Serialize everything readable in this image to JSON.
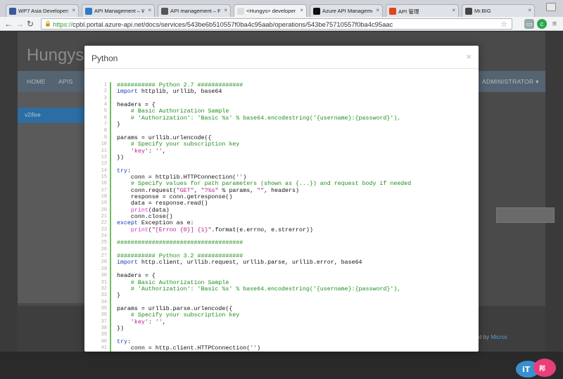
{
  "browser": {
    "tabs": [
      {
        "label": "WP7 Asia Developers",
        "favicon": "facebook-icon",
        "color": "#3b5998"
      },
      {
        "label": "API Management – Wi",
        "favicon": "windows-icon",
        "color": "#2d7cc4"
      },
      {
        "label": "API management – Pol",
        "favicon": "cloud-icon",
        "color": "#555555"
      },
      {
        "label": "<Hungys> developer",
        "favicon": "document-icon",
        "color": "#dddddd",
        "active": true
      },
      {
        "label": "Azure API Management",
        "favicon": "m-icon",
        "color": "#111111"
      },
      {
        "label": "API 管理",
        "favicon": "microsoft-icon",
        "color": "#e2441b"
      },
      {
        "label": "Mr.BIG",
        "favicon": "s-icon",
        "color": "#444444"
      }
    ],
    "url_scheme": "https://",
    "url_rest": "cpbl.portal.azure-api.net/docs/services/543be6b510557f0ba4c95aab/operations/543be75710557f0ba4c95aac"
  },
  "page": {
    "brand": "Hungys /",
    "nav": [
      "HOME",
      "APIS",
      "ADMINISTRATOR ▾"
    ],
    "sidebar_item": "v2/live",
    "footer_text": "d by",
    "footer_brand": "Micros"
  },
  "modal": {
    "title": "Python",
    "close": "×",
    "lines": [
      {
        "n": "1",
        "tokens": [
          {
            "t": "########### Python 2.7 #############",
            "c": "comment"
          }
        ]
      },
      {
        "n": "2",
        "tokens": [
          {
            "t": "import",
            "c": "kw"
          },
          {
            "t": " httplib, urllib, base64",
            "c": "plain"
          }
        ]
      },
      {
        "n": "3",
        "tokens": []
      },
      {
        "n": "4",
        "tokens": [
          {
            "t": "headers = {",
            "c": "plain"
          }
        ]
      },
      {
        "n": "5",
        "tokens": [
          {
            "t": "    # Basic Authorization Sample",
            "c": "comment"
          }
        ]
      },
      {
        "n": "6",
        "tokens": [
          {
            "t": "    # 'Authorization': 'Basic %s' % base64.encodestring('{username}:{password}'),",
            "c": "comment"
          }
        ]
      },
      {
        "n": "7",
        "tokens": [
          {
            "t": "}",
            "c": "plain"
          }
        ]
      },
      {
        "n": "8",
        "tokens": []
      },
      {
        "n": "9",
        "tokens": [
          {
            "t": "params = urllib.urlencode({",
            "c": "plain"
          }
        ]
      },
      {
        "n": "10",
        "tokens": [
          {
            "t": "    # Specify your subscription key",
            "c": "comment"
          }
        ]
      },
      {
        "n": "11",
        "tokens": [
          {
            "t": "    ",
            "c": "plain"
          },
          {
            "t": "'key'",
            "c": "str"
          },
          {
            "t": ": ",
            "c": "plain"
          },
          {
            "t": "''",
            "c": "str"
          },
          {
            "t": ",",
            "c": "plain"
          }
        ]
      },
      {
        "n": "12",
        "tokens": [
          {
            "t": "})",
            "c": "plain"
          }
        ]
      },
      {
        "n": "13",
        "tokens": []
      },
      {
        "n": "14",
        "tokens": [
          {
            "t": "try",
            "c": "kw"
          },
          {
            "t": ":",
            "c": "plain"
          }
        ]
      },
      {
        "n": "15",
        "tokens": [
          {
            "t": "    conn = httplib.HTTPConnection(",
            "c": "plain"
          },
          {
            "t": "''",
            "c": "str"
          },
          {
            "t": ")",
            "c": "plain"
          }
        ]
      },
      {
        "n": "16",
        "tokens": [
          {
            "t": "    # Specify values for path parameters (shown as {...}) and request body if needed",
            "c": "comment"
          }
        ]
      },
      {
        "n": "17",
        "tokens": [
          {
            "t": "    conn.request(",
            "c": "plain"
          },
          {
            "t": "\"GET\"",
            "c": "str"
          },
          {
            "t": ", ",
            "c": "plain"
          },
          {
            "t": "\"?%s\"",
            "c": "str"
          },
          {
            "t": " % params, ",
            "c": "plain"
          },
          {
            "t": "\"\"",
            "c": "str"
          },
          {
            "t": ", headers)",
            "c": "plain"
          }
        ]
      },
      {
        "n": "18",
        "tokens": [
          {
            "t": "    response = conn.getresponse()",
            "c": "plain"
          }
        ]
      },
      {
        "n": "19",
        "tokens": [
          {
            "t": "    data = response.read()",
            "c": "plain"
          }
        ]
      },
      {
        "n": "20",
        "tokens": [
          {
            "t": "    ",
            "c": "plain"
          },
          {
            "t": "print",
            "c": "fn"
          },
          {
            "t": "(data)",
            "c": "plain"
          }
        ]
      },
      {
        "n": "21",
        "tokens": [
          {
            "t": "    conn.close()",
            "c": "plain"
          }
        ]
      },
      {
        "n": "22",
        "tokens": [
          {
            "t": "except",
            "c": "kw"
          },
          {
            "t": " Exception as e:",
            "c": "plain"
          }
        ]
      },
      {
        "n": "23",
        "tokens": [
          {
            "t": "    ",
            "c": "plain"
          },
          {
            "t": "print",
            "c": "fn"
          },
          {
            "t": "(",
            "c": "plain"
          },
          {
            "t": "\"[Errno {0}] {1}\"",
            "c": "str"
          },
          {
            "t": ".format(e.errno, e.strerror))",
            "c": "plain"
          }
        ]
      },
      {
        "n": "24",
        "tokens": []
      },
      {
        "n": "25",
        "tokens": [
          {
            "t": "####################################",
            "c": "comment"
          }
        ]
      },
      {
        "n": "26",
        "tokens": []
      },
      {
        "n": "27",
        "tokens": [
          {
            "t": "########### Python 3.2 #############",
            "c": "comment"
          }
        ]
      },
      {
        "n": "28",
        "tokens": [
          {
            "t": "import",
            "c": "kw"
          },
          {
            "t": " http.client, urllib.request, urllib.parse, urllib.error, base64",
            "c": "plain"
          }
        ]
      },
      {
        "n": "29",
        "tokens": []
      },
      {
        "n": "30",
        "tokens": [
          {
            "t": "headers = {",
            "c": "plain"
          }
        ]
      },
      {
        "n": "31",
        "tokens": [
          {
            "t": "    # Basic Authorization Sample",
            "c": "comment"
          }
        ]
      },
      {
        "n": "32",
        "tokens": [
          {
            "t": "    # 'Authorization': 'Basic %s' % base64.encodestring('{username}:{password}'),",
            "c": "comment"
          }
        ]
      },
      {
        "n": "33",
        "tokens": [
          {
            "t": "}",
            "c": "plain"
          }
        ]
      },
      {
        "n": "34",
        "tokens": []
      },
      {
        "n": "35",
        "tokens": [
          {
            "t": "params = urllib.parse.urlencode({",
            "c": "plain"
          }
        ]
      },
      {
        "n": "36",
        "tokens": [
          {
            "t": "    # Specify your subscription key",
            "c": "comment"
          }
        ]
      },
      {
        "n": "37",
        "tokens": [
          {
            "t": "    ",
            "c": "plain"
          },
          {
            "t": "'key'",
            "c": "str"
          },
          {
            "t": ": ",
            "c": "plain"
          },
          {
            "t": "''",
            "c": "str"
          },
          {
            "t": ",",
            "c": "plain"
          }
        ]
      },
      {
        "n": "38",
        "tokens": [
          {
            "t": "})",
            "c": "plain"
          }
        ]
      },
      {
        "n": "39",
        "tokens": []
      },
      {
        "n": "40",
        "tokens": [
          {
            "t": "try",
            "c": "kw"
          },
          {
            "t": ":",
            "c": "plain"
          }
        ]
      },
      {
        "n": "41",
        "tokens": [
          {
            "t": "    conn = http.client.HTTPConnection(",
            "c": "plain"
          },
          {
            "t": "''",
            "c": "str"
          },
          {
            "t": ")",
            "c": "plain"
          }
        ]
      }
    ]
  },
  "colors": {
    "comment": "#1f8f1f",
    "keyword": "#1b3bb5",
    "string": "#b5208e",
    "function": "#d23ac8",
    "gutter_bar": "#6fbf5f",
    "sidebar_active": "#2c6ea3"
  }
}
